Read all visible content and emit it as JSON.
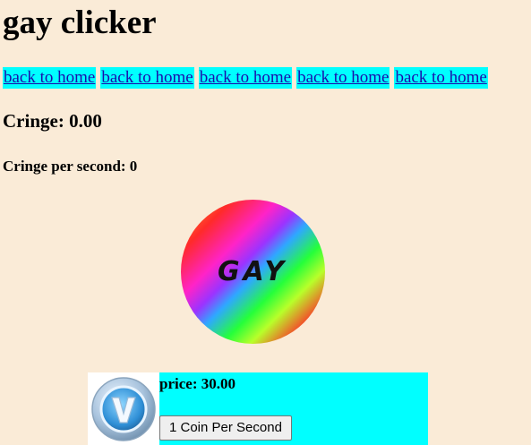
{
  "header": {
    "title": "gay clicker"
  },
  "nav": {
    "links": [
      {
        "label": "back to home"
      },
      {
        "label": "back to home"
      },
      {
        "label": "back to home"
      },
      {
        "label": "back to home"
      },
      {
        "label": "back to home"
      }
    ],
    "link_background": "#00FFFF",
    "link_color": "#1a0dab"
  },
  "stats": {
    "cringe_label": "Cringe: 0.00",
    "cringe_per_second_label": "Cringe per second: 0"
  },
  "clicker": {
    "text": "GAY",
    "icon": "rainbow-circle-button"
  },
  "shop": {
    "item": {
      "icon": "fortnite-vbucks-coin-icon",
      "price_label": "price: 30.00",
      "button_label": "1 Coin Per Second",
      "background": "#00FFFF"
    }
  },
  "colors": {
    "page_background": "#FAEBD7"
  }
}
